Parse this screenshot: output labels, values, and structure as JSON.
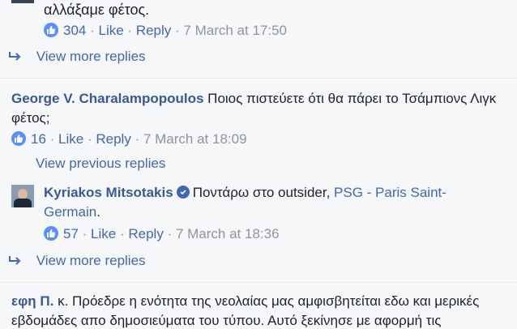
{
  "comment0": {
    "text_tail": "αλλάξαμε φέτος.",
    "likes": "304",
    "like_label": "Like",
    "reply_label": "Reply",
    "time": "7 March at 17:50"
  },
  "view_more_1": "View more replies",
  "comment1": {
    "author": "George V. Charalampopoulos",
    "text_line1": "Ποιος πιστεύετε ότι θα πάρει το Τσάμπιονς Λιγκ",
    "text_line2": "φέτος;",
    "likes": "16",
    "like_label": "Like",
    "reply_label": "Reply",
    "time": "7 March at 18:09"
  },
  "view_previous": "View previous replies",
  "reply1": {
    "author": "Kyriakos Mitsotakis",
    "text": "Ποντάρω στο outsider,",
    "link_line1": "PSG - Paris Saint-",
    "link_line2": "Germain",
    "trailing": ".",
    "likes": "57",
    "like_label": "Like",
    "reply_label": "Reply",
    "time": "7 March at 18:36"
  },
  "view_more_2": "View more replies",
  "comment2": {
    "author": "εφη Π.",
    "text_line1": "κ. Πρόεδρε η ενότητα της νεολαίας μας αμφισβητείται εδω και μερικές",
    "text_line2": "εβδομάδες απο δημοσιεύματα του τύπου. Αυτό ξεκίνησε με αφορμή τις"
  },
  "colors": {
    "link": "#4267b2",
    "name": "#385898",
    "meta": "#90949c",
    "like_blue": "#5890ff",
    "background": "#f6f7f9"
  },
  "icons": [
    "like-thumb-icon",
    "reply-arrow-icon",
    "verified-badge-icon",
    "avatar"
  ]
}
